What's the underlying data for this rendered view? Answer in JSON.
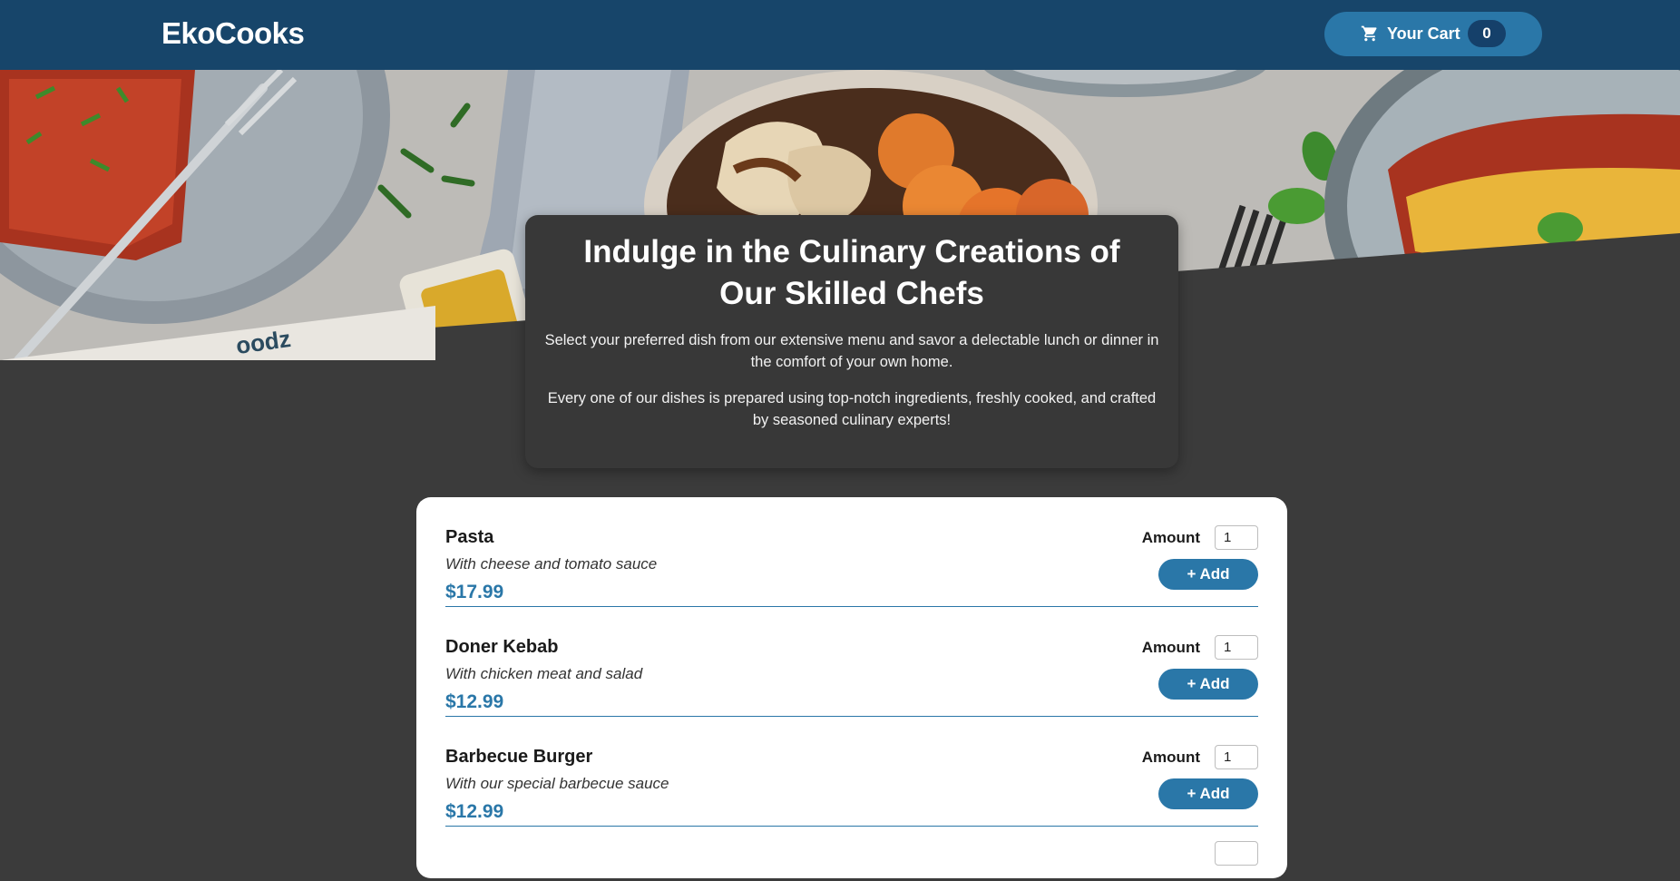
{
  "header": {
    "brand": "EkoCooks",
    "cart_label": "Your Cart",
    "cart_count": "0"
  },
  "intro": {
    "title": "Indulge in the Culinary Creations of Our Skilled Chefs",
    "paragraph1": "Select your preferred dish from our extensive menu and savor a delectable lunch or dinner in the comfort of your own home.",
    "paragraph2": "Every one of our dishes is prepared using top-notch ingredients, freshly cooked, and crafted by seasoned culinary experts!"
  },
  "meals": [
    {
      "name": "Pasta",
      "description": "With cheese and tomato sauce",
      "price": "$17.99",
      "amount_label": "Amount",
      "amount_value": "1",
      "add_label": "+ Add"
    },
    {
      "name": "Doner Kebab",
      "description": "With chicken meat and salad",
      "price": "$12.99",
      "amount_label": "Amount",
      "amount_value": "1",
      "add_label": "+ Add"
    },
    {
      "name": "Barbecue Burger",
      "description": "With our special barbecue sauce",
      "price": "$12.99",
      "amount_label": "Amount",
      "amount_value": "1",
      "add_label": "+ Add"
    }
  ],
  "hero_watermark": "oodz",
  "icons": {
    "cart": "cart-icon"
  },
  "colors": {
    "header_bg": "#17456a",
    "accent": "#2a77a8",
    "page_bg": "#3b3b3b",
    "card_bg": "#383838"
  }
}
